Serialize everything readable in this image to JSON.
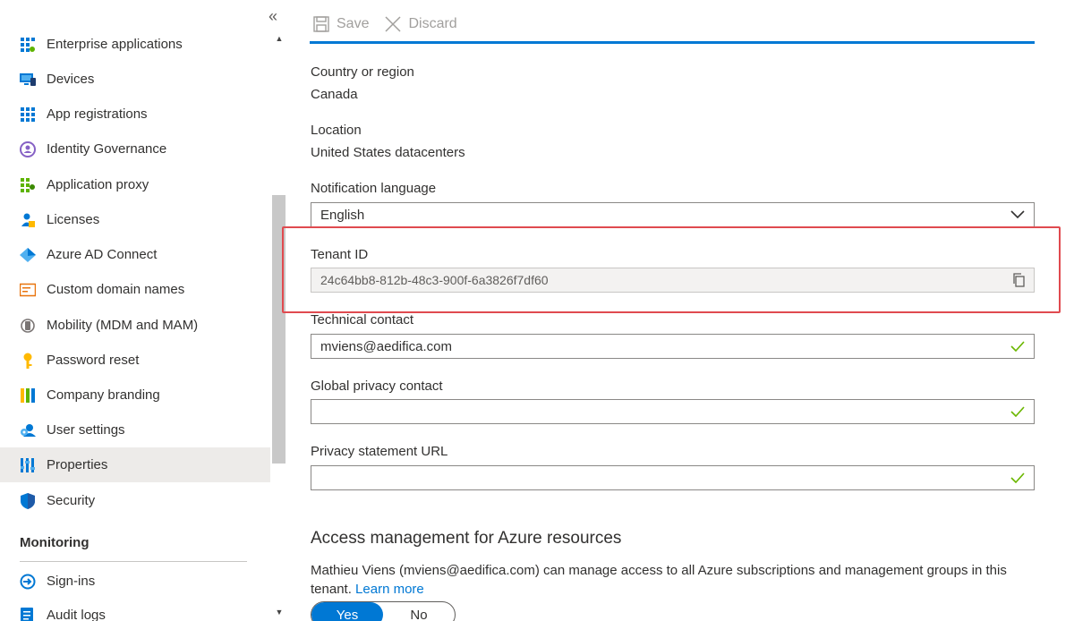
{
  "sidebar": {
    "items": [
      {
        "label": "Enterprise applications",
        "icon": "grid-apps-icon"
      },
      {
        "label": "Devices",
        "icon": "monitor-icon"
      },
      {
        "label": "App registrations",
        "icon": "grid-apps-icon"
      },
      {
        "label": "Identity Governance",
        "icon": "identity-governance-icon"
      },
      {
        "label": "Application proxy",
        "icon": "application-proxy-icon"
      },
      {
        "label": "Licenses",
        "icon": "license-user-icon"
      },
      {
        "label": "Azure AD Connect",
        "icon": "diamond-icon"
      },
      {
        "label": "Custom domain names",
        "icon": "domain-card-icon"
      },
      {
        "label": "Mobility (MDM and MAM)",
        "icon": "mobility-icon"
      },
      {
        "label": "Password reset",
        "icon": "key-icon"
      },
      {
        "label": "Company branding",
        "icon": "bars-icon"
      },
      {
        "label": "User settings",
        "icon": "user-gear-icon"
      },
      {
        "label": "Properties",
        "icon": "properties-icon"
      },
      {
        "label": "Security",
        "icon": "shield-icon"
      }
    ],
    "selected": "Properties",
    "monitoring_heading": "Monitoring",
    "monitoring_items": [
      {
        "label": "Sign-ins",
        "icon": "sign-in-icon"
      },
      {
        "label": "Audit logs",
        "icon": "audit-log-icon"
      }
    ]
  },
  "toolbar": {
    "collapse_glyph": "«",
    "save_label": "Save",
    "discard_label": "Discard"
  },
  "form": {
    "country_label": "Country or region",
    "country_value": "Canada",
    "location_label": "Location",
    "location_value": "United States datacenters",
    "language_label": "Notification language",
    "language_value": "English",
    "tenant_label": "Tenant ID",
    "tenant_value": "24c64bb8-812b-48c3-900f-6a3826f7df60",
    "tech_contact_label": "Technical contact",
    "tech_contact_value": "mviens@aedifica.com",
    "privacy_contact_label": "Global privacy contact",
    "privacy_contact_value": "",
    "privacy_url_label": "Privacy statement URL",
    "privacy_url_value": ""
  },
  "access": {
    "heading": "Access management for Azure resources",
    "text": "Mathieu Viens (mviens@aedifica.com) can manage access to all Azure subscriptions and management groups in this tenant.",
    "link": "Learn more",
    "yes_label": "Yes",
    "no_label": "No",
    "selected": "Yes"
  },
  "colors": {
    "accent": "#0078d4",
    "highlight_box": "#e04a4f",
    "valid_check": "#6bb700",
    "selected_nav": "#edebe9"
  }
}
